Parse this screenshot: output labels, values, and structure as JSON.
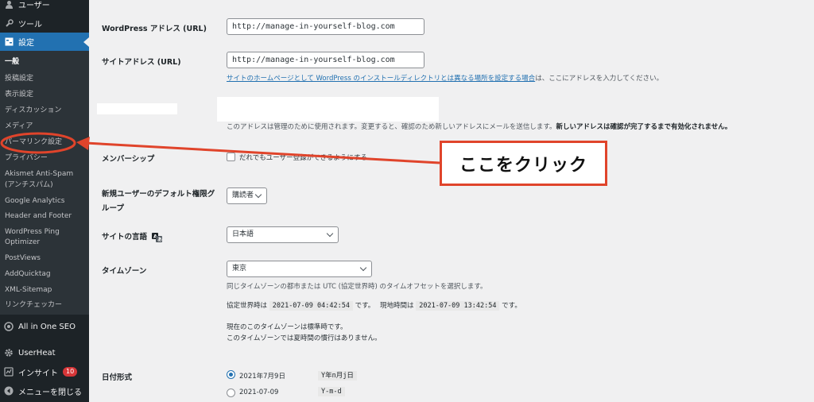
{
  "sidebar": {
    "menu": [
      {
        "label": "ユーザー",
        "icon": "user-icon"
      },
      {
        "label": "ツール",
        "icon": "wrench-icon"
      },
      {
        "label": "設定",
        "icon": "settings-icon"
      }
    ],
    "submenu": [
      "一般",
      "投稿設定",
      "表示設定",
      "ディスカッション",
      "メディア",
      "パーマリンク設定",
      "プライバシー",
      "Akismet Anti-Spam",
      "(アンチスパム)",
      "Google Analytics",
      "Header and Footer",
      "WordPress Ping",
      "Optimizer",
      "PostViews",
      "AddQuicktag",
      "XML-Sitemap",
      "リンクチェッカー"
    ],
    "bottom_menu": [
      {
        "label": "All in One SEO",
        "icon": "aioseo-icon"
      },
      {
        "label": "UserHeat",
        "icon": "gear-icon"
      },
      {
        "label": "インサイト",
        "icon": "insights-icon",
        "badge": "10"
      },
      {
        "label": "メニューを閉じる",
        "icon": "collapse-icon"
      }
    ]
  },
  "settings": {
    "wp_address_label": "WordPress アドレス (URL)",
    "wp_address_value": "http://manage-in-yourself-blog.com",
    "site_address_label": "サイトアドレス (URL)",
    "site_address_value": "http://manage-in-yourself-blog.com",
    "site_address_link": "サイトのホームページとして WordPress のインストールディレクトリとは異なる場所を設定する場合",
    "site_address_desc": "は、ここにアドレスを入力してください。",
    "admin_email_desc": "このアドレスは管理のために使用されます。変更すると、確認のため新しいアドレスにメールを送信します。",
    "admin_email_desc_bold": "新しいアドレスは確認が完了するまで有効化されません。",
    "membership_label": "メンバーシップ",
    "membership_checkbox": "だれでもユーザー登録ができるようにする",
    "default_role_label_1": "新規ユーザーのデフォルト権限グ",
    "default_role_label_2": "ループ",
    "default_role_value": "購読者",
    "language_label": "サイトの言語",
    "language_value": "日本語",
    "timezone_label": "タイムゾーン",
    "timezone_value": "東京",
    "timezone_desc": "同じタイムゾーンの都市または UTC (協定世界時) のタイムオフセットを選択します。",
    "utc_prefix": "協定世界時は",
    "utc_time": "2021-07-09 04:42:54",
    "utc_suffix": "です。",
    "local_prefix": "現地時間は",
    "local_time": "2021-07-09 13:42:54",
    "local_suffix": "です。",
    "tz_note_1": "現在のこのタイムゾーンは標準時です。",
    "tz_note_2": "このタイムゾーンでは夏時間の慣行はありません。",
    "date_format_label": "日付形式",
    "date_options": [
      {
        "label": "2021年7月9日",
        "code": "Y年n月j日",
        "checked": true
      },
      {
        "label": "2021-07-09",
        "code": "Y-m-d",
        "checked": false
      }
    ]
  },
  "annotation": {
    "callout": "ここをクリック",
    "color": "#e0442b"
  },
  "colors": {
    "sidebar_bg": "#1d2327",
    "submenu_bg": "#2c3338",
    "accent": "#2271b1",
    "badge": "#d63638"
  }
}
